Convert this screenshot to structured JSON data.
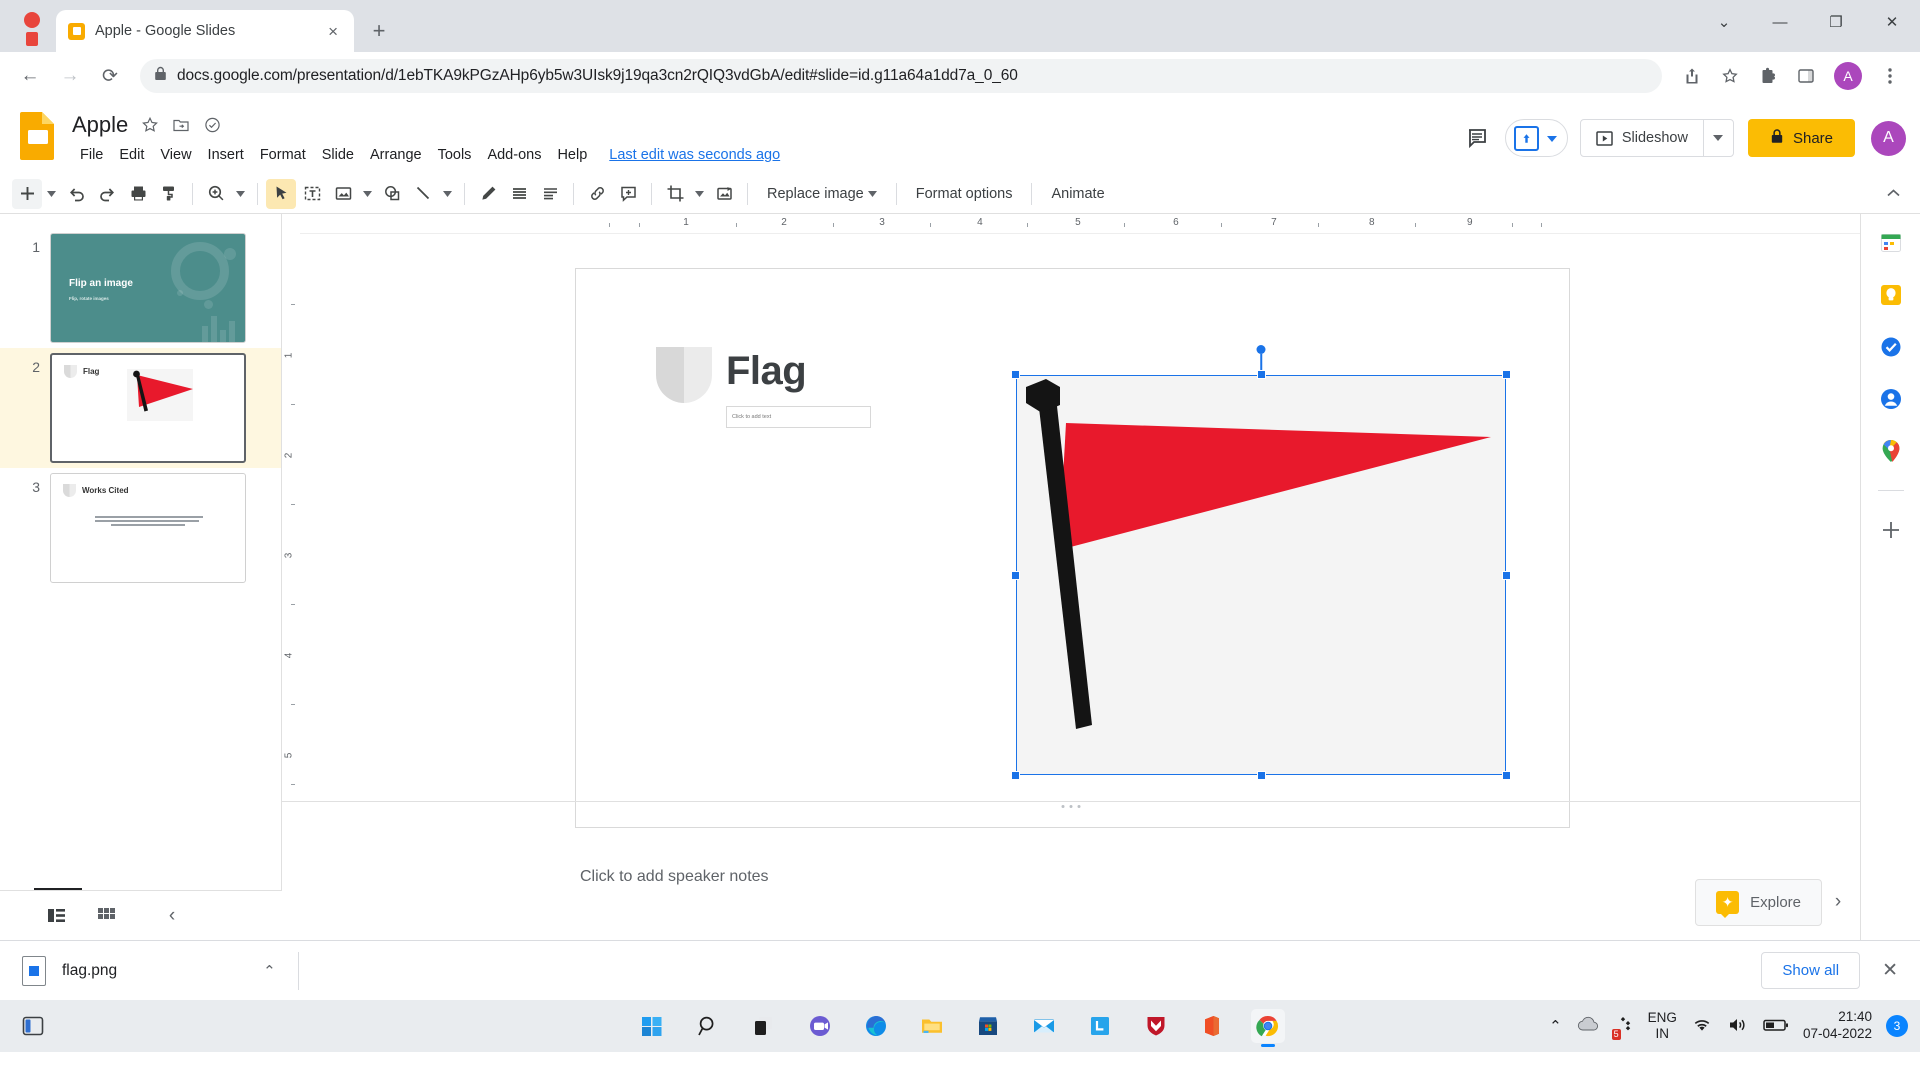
{
  "browser": {
    "tab": {
      "title": "Apple - Google Slides",
      "favicon": "slides-icon",
      "close": "×"
    },
    "new_tab": "+",
    "window_controls": {
      "minimize_extra": "⌄",
      "minimize": "—",
      "maximize": "❐",
      "close": "✕"
    },
    "nav": {
      "back": "←",
      "forward": "→",
      "reload": "⟳"
    },
    "url_lock": "lock-icon",
    "url_prefix": "docs.google.com",
    "url_rest": "/presentation/d/1ebTKA9kPGzAHp6yb5w3UIsk9j19qa3cn2rQIQ3vdGbA/edit#slide=id.g11a64a1dd7a_0_60",
    "url_full": "docs.google.com/presentation/d/1ebTKA9kPGzAHp6yb5w3UIsk9j19qa3cn2rQIQ3vdGbA/edit#slide=id.g11a64a1dd7a_0_60",
    "profile_initial": "A"
  },
  "slides_header": {
    "doc_title": "Apple",
    "star": "star-icon",
    "move": "move-to-folder-icon",
    "cloud": "cloud-saved-icon",
    "menus": [
      "File",
      "Edit",
      "View",
      "Insert",
      "Format",
      "Slide",
      "Arrange",
      "Tools",
      "Add-ons",
      "Help"
    ],
    "last_edit": "Last edit was seconds ago",
    "comment_icon": "comment-icon",
    "present_label": "Slideshow",
    "present_caret": "▾",
    "share_label": "Share",
    "share_lock": "lock-icon",
    "share_color": "#fbbc04",
    "avatar_initial": "A",
    "avatar_color": "#ab47bc"
  },
  "toolbar": {
    "new_slide": "+",
    "undo": "undo-icon",
    "redo": "redo-icon",
    "print": "print-icon",
    "paint": "paint-format-icon",
    "zoom": "zoom-icon",
    "select": "cursor-icon",
    "textbox": "text-box-icon",
    "image": "image-icon",
    "shape": "shape-icon",
    "line": "line-icon",
    "pen": "pen-icon",
    "align": "align-icon",
    "line_spacing": "line-spacing-icon",
    "link": "link-icon",
    "comment": "add-comment-icon",
    "crop": "crop-icon",
    "mask": "mask-image-icon",
    "replace_image": "Replace image",
    "format_options": "Format options",
    "animate": "Animate",
    "collapse": "collapse-toolbar-icon"
  },
  "filmstrip": {
    "slides": [
      {
        "num": "1",
        "title": "Flip an image",
        "subtitle": "Flip, rotate images",
        "selected": false
      },
      {
        "num": "2",
        "title": "Flag",
        "subtitle": "",
        "selected": true
      },
      {
        "num": "3",
        "title": "Works Cited",
        "subtitle": "",
        "selected": false
      }
    ],
    "bottom": {
      "filmstrip_view": "filmstrip-view-icon",
      "grid_view": "grid-view-icon",
      "collapse": "‹"
    }
  },
  "canvas": {
    "ruler_h": [
      "1",
      "2",
      "3",
      "4",
      "5",
      "6",
      "7",
      "8",
      "9"
    ],
    "ruler_v": [
      "1",
      "2",
      "3",
      "4",
      "5"
    ],
    "slide": {
      "title": "Flag",
      "body_placeholder": "Click to add text",
      "image": {
        "name": "flag-image",
        "selected": true,
        "flag_color": "#e8192c",
        "pole_color": "#141414",
        "background": "#f4f4f4"
      }
    }
  },
  "notes": {
    "placeholder": "Click to add speaker notes",
    "explore_label": "Explore",
    "expand": "›"
  },
  "sidebar_right": {
    "items": [
      {
        "name": "google-calendar-icon",
        "label": "Calendar"
      },
      {
        "name": "google-keep-icon",
        "label": "Keep"
      },
      {
        "name": "google-tasks-icon",
        "label": "Tasks"
      },
      {
        "name": "google-contacts-icon",
        "label": "Contacts"
      },
      {
        "name": "google-maps-icon",
        "label": "Maps"
      }
    ],
    "add": "+"
  },
  "download_bar": {
    "file_name": "flag.png",
    "caret": "⌃",
    "show_all": "Show all",
    "close": "✕"
  },
  "taskbar": {
    "widgets": "widgets-icon",
    "apps": [
      {
        "name": "windows-start-icon"
      },
      {
        "name": "search-icon"
      },
      {
        "name": "task-view-icon"
      },
      {
        "name": "teams-icon"
      },
      {
        "name": "microsoft-edge-icon"
      },
      {
        "name": "file-explorer-icon"
      },
      {
        "name": "microsoft-store-icon"
      },
      {
        "name": "mail-icon"
      },
      {
        "name": "lenovo-icon"
      },
      {
        "name": "mcafee-icon"
      },
      {
        "name": "office-icon"
      },
      {
        "name": "google-chrome-icon",
        "active": true
      }
    ],
    "tray": {
      "chevron": "⌃",
      "onedrive": "onedrive-icon",
      "update_badge": "5",
      "lang_line1": "ENG",
      "lang_line2": "IN",
      "wifi": "wifi-icon",
      "volume": "volume-icon",
      "battery": "battery-icon",
      "time": "21:40",
      "date": "07-04-2022",
      "notif_count": "3"
    }
  }
}
